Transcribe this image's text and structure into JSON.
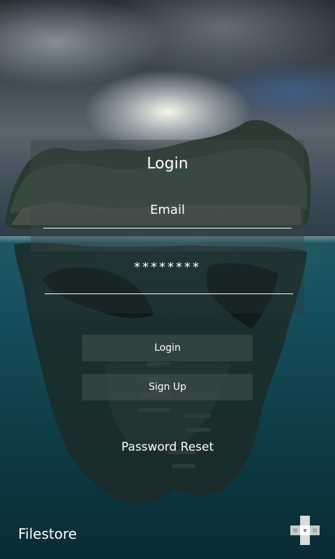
{
  "login_card": {
    "title": "Login",
    "email_placeholder": "Email",
    "password_value": "********"
  },
  "buttons": {
    "login_label": "Login",
    "signup_label": "Sign Up"
  },
  "links": {
    "password_reset": "Password Reset"
  },
  "footer": {
    "app_name": "Filestore",
    "app_icon": "pixel-cross-icon"
  },
  "colors": {
    "text": "#ffffff",
    "panel": "#464f52",
    "water": "#11444f"
  }
}
